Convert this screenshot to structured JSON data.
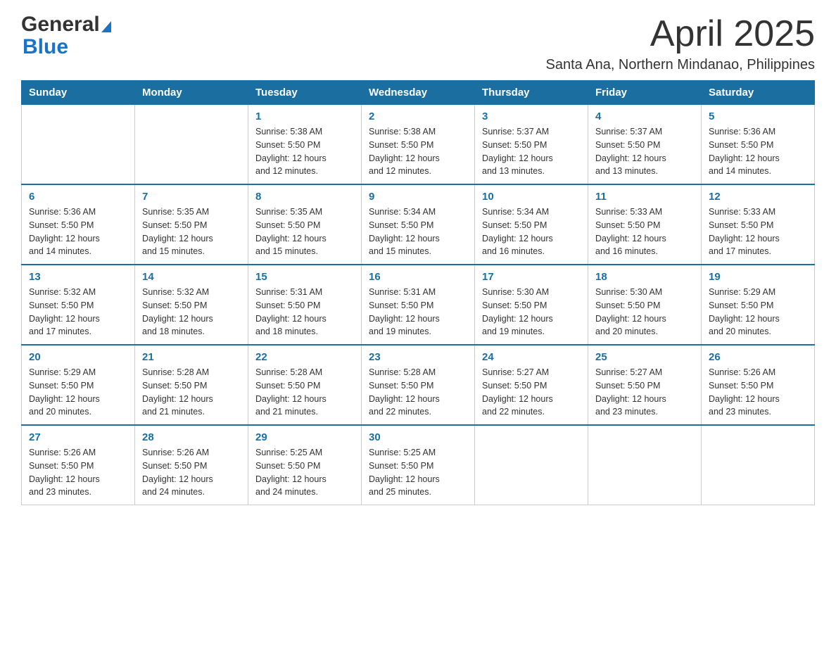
{
  "logo": {
    "general": "General",
    "blue": "Blue"
  },
  "header": {
    "title": "April 2025",
    "subtitle": "Santa Ana, Northern Mindanao, Philippines"
  },
  "calendar": {
    "days_of_week": [
      "Sunday",
      "Monday",
      "Tuesday",
      "Wednesday",
      "Thursday",
      "Friday",
      "Saturday"
    ],
    "weeks": [
      [
        {
          "day": "",
          "info": ""
        },
        {
          "day": "",
          "info": ""
        },
        {
          "day": "1",
          "info": "Sunrise: 5:38 AM\nSunset: 5:50 PM\nDaylight: 12 hours\nand 12 minutes."
        },
        {
          "day": "2",
          "info": "Sunrise: 5:38 AM\nSunset: 5:50 PM\nDaylight: 12 hours\nand 12 minutes."
        },
        {
          "day": "3",
          "info": "Sunrise: 5:37 AM\nSunset: 5:50 PM\nDaylight: 12 hours\nand 13 minutes."
        },
        {
          "day": "4",
          "info": "Sunrise: 5:37 AM\nSunset: 5:50 PM\nDaylight: 12 hours\nand 13 minutes."
        },
        {
          "day": "5",
          "info": "Sunrise: 5:36 AM\nSunset: 5:50 PM\nDaylight: 12 hours\nand 14 minutes."
        }
      ],
      [
        {
          "day": "6",
          "info": "Sunrise: 5:36 AM\nSunset: 5:50 PM\nDaylight: 12 hours\nand 14 minutes."
        },
        {
          "day": "7",
          "info": "Sunrise: 5:35 AM\nSunset: 5:50 PM\nDaylight: 12 hours\nand 15 minutes."
        },
        {
          "day": "8",
          "info": "Sunrise: 5:35 AM\nSunset: 5:50 PM\nDaylight: 12 hours\nand 15 minutes."
        },
        {
          "day": "9",
          "info": "Sunrise: 5:34 AM\nSunset: 5:50 PM\nDaylight: 12 hours\nand 15 minutes."
        },
        {
          "day": "10",
          "info": "Sunrise: 5:34 AM\nSunset: 5:50 PM\nDaylight: 12 hours\nand 16 minutes."
        },
        {
          "day": "11",
          "info": "Sunrise: 5:33 AM\nSunset: 5:50 PM\nDaylight: 12 hours\nand 16 minutes."
        },
        {
          "day": "12",
          "info": "Sunrise: 5:33 AM\nSunset: 5:50 PM\nDaylight: 12 hours\nand 17 minutes."
        }
      ],
      [
        {
          "day": "13",
          "info": "Sunrise: 5:32 AM\nSunset: 5:50 PM\nDaylight: 12 hours\nand 17 minutes."
        },
        {
          "day": "14",
          "info": "Sunrise: 5:32 AM\nSunset: 5:50 PM\nDaylight: 12 hours\nand 18 minutes."
        },
        {
          "day": "15",
          "info": "Sunrise: 5:31 AM\nSunset: 5:50 PM\nDaylight: 12 hours\nand 18 minutes."
        },
        {
          "day": "16",
          "info": "Sunrise: 5:31 AM\nSunset: 5:50 PM\nDaylight: 12 hours\nand 19 minutes."
        },
        {
          "day": "17",
          "info": "Sunrise: 5:30 AM\nSunset: 5:50 PM\nDaylight: 12 hours\nand 19 minutes."
        },
        {
          "day": "18",
          "info": "Sunrise: 5:30 AM\nSunset: 5:50 PM\nDaylight: 12 hours\nand 20 minutes."
        },
        {
          "day": "19",
          "info": "Sunrise: 5:29 AM\nSunset: 5:50 PM\nDaylight: 12 hours\nand 20 minutes."
        }
      ],
      [
        {
          "day": "20",
          "info": "Sunrise: 5:29 AM\nSunset: 5:50 PM\nDaylight: 12 hours\nand 20 minutes."
        },
        {
          "day": "21",
          "info": "Sunrise: 5:28 AM\nSunset: 5:50 PM\nDaylight: 12 hours\nand 21 minutes."
        },
        {
          "day": "22",
          "info": "Sunrise: 5:28 AM\nSunset: 5:50 PM\nDaylight: 12 hours\nand 21 minutes."
        },
        {
          "day": "23",
          "info": "Sunrise: 5:28 AM\nSunset: 5:50 PM\nDaylight: 12 hours\nand 22 minutes."
        },
        {
          "day": "24",
          "info": "Sunrise: 5:27 AM\nSunset: 5:50 PM\nDaylight: 12 hours\nand 22 minutes."
        },
        {
          "day": "25",
          "info": "Sunrise: 5:27 AM\nSunset: 5:50 PM\nDaylight: 12 hours\nand 23 minutes."
        },
        {
          "day": "26",
          "info": "Sunrise: 5:26 AM\nSunset: 5:50 PM\nDaylight: 12 hours\nand 23 minutes."
        }
      ],
      [
        {
          "day": "27",
          "info": "Sunrise: 5:26 AM\nSunset: 5:50 PM\nDaylight: 12 hours\nand 23 minutes."
        },
        {
          "day": "28",
          "info": "Sunrise: 5:26 AM\nSunset: 5:50 PM\nDaylight: 12 hours\nand 24 minutes."
        },
        {
          "day": "29",
          "info": "Sunrise: 5:25 AM\nSunset: 5:50 PM\nDaylight: 12 hours\nand 24 minutes."
        },
        {
          "day": "30",
          "info": "Sunrise: 5:25 AM\nSunset: 5:50 PM\nDaylight: 12 hours\nand 25 minutes."
        },
        {
          "day": "",
          "info": ""
        },
        {
          "day": "",
          "info": ""
        },
        {
          "day": "",
          "info": ""
        }
      ]
    ]
  }
}
